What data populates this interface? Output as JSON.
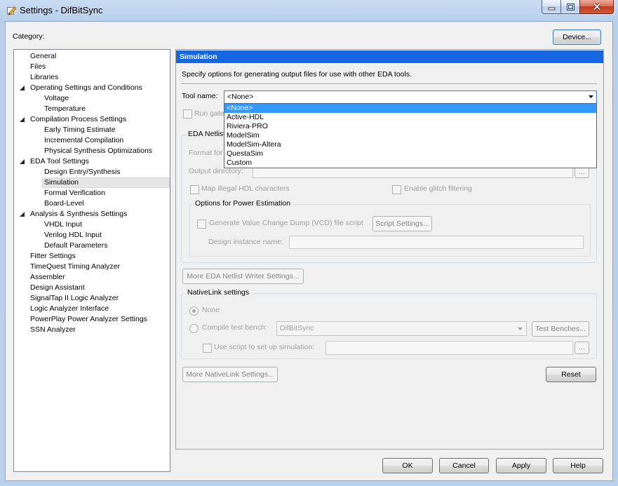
{
  "window": {
    "title": "Settings - DifBitSync",
    "icon": "pencil-icon",
    "controls": [
      "minimize-icon",
      "maximize-icon",
      "close-icon"
    ]
  },
  "category_label": "Category:",
  "device_button": "Device...",
  "tree": {
    "expander_icon": "expanded-arrow-icon",
    "items": [
      {
        "label": "General",
        "level": 0
      },
      {
        "label": "Files",
        "level": 0
      },
      {
        "label": "Libraries",
        "level": 0
      },
      {
        "label": "Operating Settings and Conditions",
        "level": 0,
        "expanded": true
      },
      {
        "label": "Voltage",
        "level": 1
      },
      {
        "label": "Temperature",
        "level": 1
      },
      {
        "label": "Compilation Process Settings",
        "level": 0,
        "expanded": true
      },
      {
        "label": "Early Timing Estimate",
        "level": 1
      },
      {
        "label": "Incremental Compilation",
        "level": 1
      },
      {
        "label": "Physical Synthesis Optimizations",
        "level": 1
      },
      {
        "label": "EDA Tool Settings",
        "level": 0,
        "expanded": true
      },
      {
        "label": "Design Entry/Synthesis",
        "level": 1
      },
      {
        "label": "Simulation",
        "level": 1,
        "selected": true
      },
      {
        "label": "Formal Verification",
        "level": 1
      },
      {
        "label": "Board-Level",
        "level": 1
      },
      {
        "label": "Analysis & Synthesis Settings",
        "level": 0,
        "expanded": true
      },
      {
        "label": "VHDL Input",
        "level": 1
      },
      {
        "label": "Verilog HDL Input",
        "level": 1
      },
      {
        "label": "Default Parameters",
        "level": 1
      },
      {
        "label": "Fitter Settings",
        "level": 0
      },
      {
        "label": "TimeQuest Timing Analyzer",
        "level": 0
      },
      {
        "label": "Assembler",
        "level": 0
      },
      {
        "label": "Design Assistant",
        "level": 0
      },
      {
        "label": "SignalTap II Logic Analyzer",
        "level": 0
      },
      {
        "label": "Logic Analyzer Interface",
        "level": 0
      },
      {
        "label": "PowerPlay Power Analyzer Settings",
        "level": 0
      },
      {
        "label": "SSN Analyzer",
        "level": 0
      }
    ]
  },
  "page": {
    "header": "Simulation",
    "description": "Specify options for generating output files for use with other EDA tools.",
    "tool_name": {
      "label": "Tool name:",
      "value": "<None>",
      "dropdown_open": true,
      "options": [
        "<None>",
        "Active-HDL",
        "Riviera-PRO",
        "ModelSim",
        "ModelSim-Altera",
        "QuestaSim",
        "Custom"
      ]
    },
    "run_gate": {
      "label": "Run gate",
      "checked": false
    },
    "eda_netlist": {
      "group_label": "EDA Netlist",
      "format_label": "Format for",
      "output_directory_label": "Output directory:",
      "browse_label": "...",
      "map_illegal_hdl": {
        "label": "Map illegal HDL characters",
        "checked": false
      },
      "enable_glitch_filtering": {
        "label": "Enable glitch filtering",
        "checked": false
      },
      "power_estimation": {
        "group_label": "Options for Power Estimation",
        "generate_vcd": {
          "label": "Generate Value Change Dump (VCD) file script",
          "checked": false
        },
        "script_settings_button": "Script Settings...",
        "design_instance_label": "Design instance name:"
      },
      "more_button": "More EDA Netlist Writer Settings..."
    },
    "nativelink": {
      "group_label": "NativeLink settings",
      "none": {
        "label": "None",
        "selected": true
      },
      "compile_test_bench": {
        "label": "Compile test bench:",
        "selected": false,
        "value": "DifBitSync",
        "button": "Test Benches..."
      },
      "use_script": {
        "label": "Use script to set up simulation:",
        "checked": false,
        "browse_label": "..."
      },
      "more_button": "More NativeLink Settings..."
    },
    "reset_button": "Reset"
  },
  "footer": {
    "ok": "OK",
    "cancel": "Cancel",
    "apply": "Apply",
    "help": "Help"
  },
  "colors": {
    "header_bg": "#1467e0",
    "selection": "#3399ff",
    "disabled_text": "#a0a0a0"
  }
}
